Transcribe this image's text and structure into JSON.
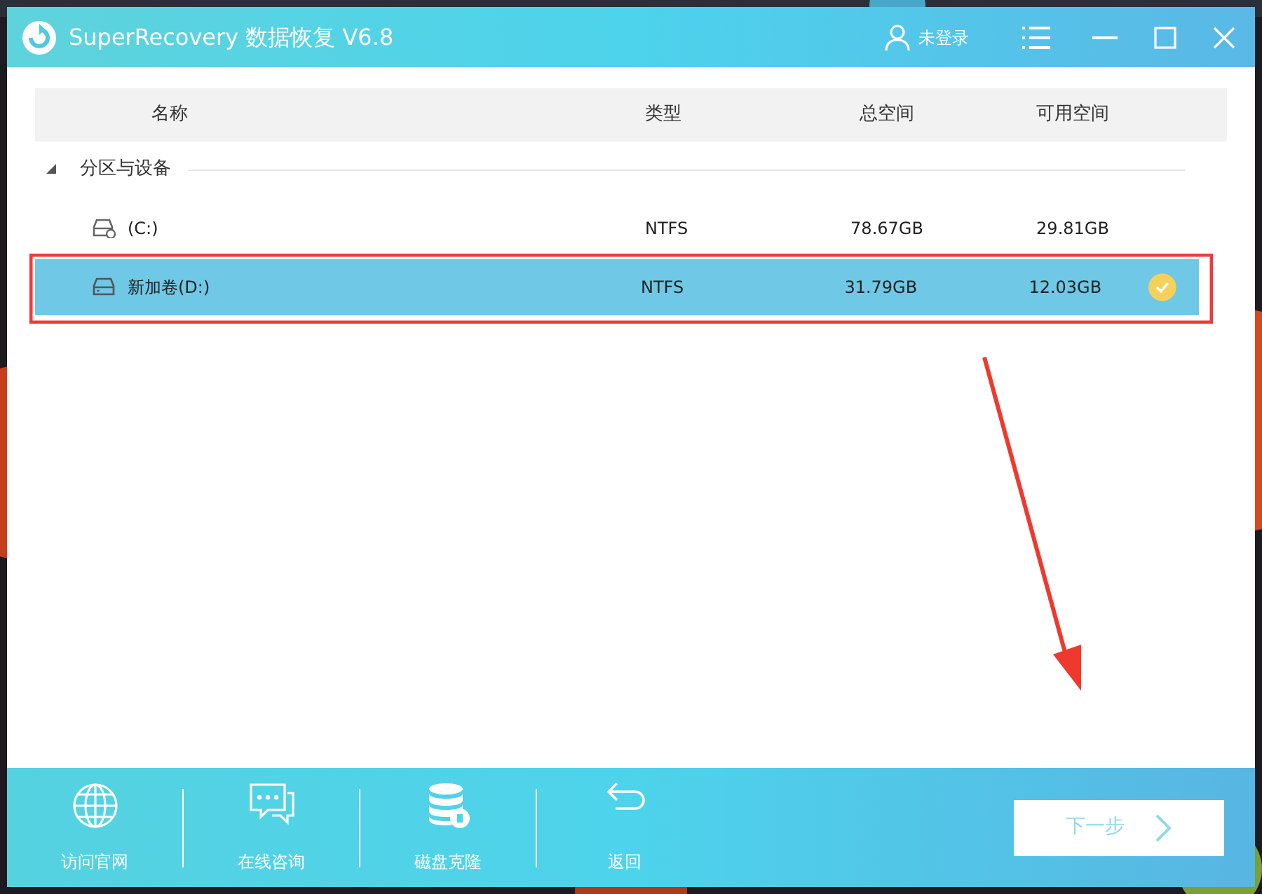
{
  "window": {
    "title": "SuperRecovery 数据恢复 V6.8",
    "user": "未登录"
  },
  "table": {
    "columns": [
      "名称",
      "类型",
      "总空间",
      "可用空间"
    ],
    "group": {
      "label": "分区与设备",
      "expanded": true
    },
    "rows": [
      {
        "kind": "system",
        "name": "(C:)",
        "type": "NTFS",
        "total": "78.67GB",
        "free": "29.81GB",
        "selected": false
      },
      {
        "kind": "disk",
        "name": "新加卷(D:)",
        "type": "NTFS",
        "total": "31.79GB",
        "free": "12.03GB",
        "selected": true
      }
    ]
  },
  "footer": {
    "tools": [
      {
        "kind": "globe",
        "label": "访问官网"
      },
      {
        "kind": "chat",
        "label": "在线咨询"
      },
      {
        "kind": "database",
        "label": "磁盘克隆"
      },
      {
        "kind": "back",
        "label": "返回"
      }
    ],
    "next": {
      "label": "下一步",
      "disabled": true
    }
  }
}
